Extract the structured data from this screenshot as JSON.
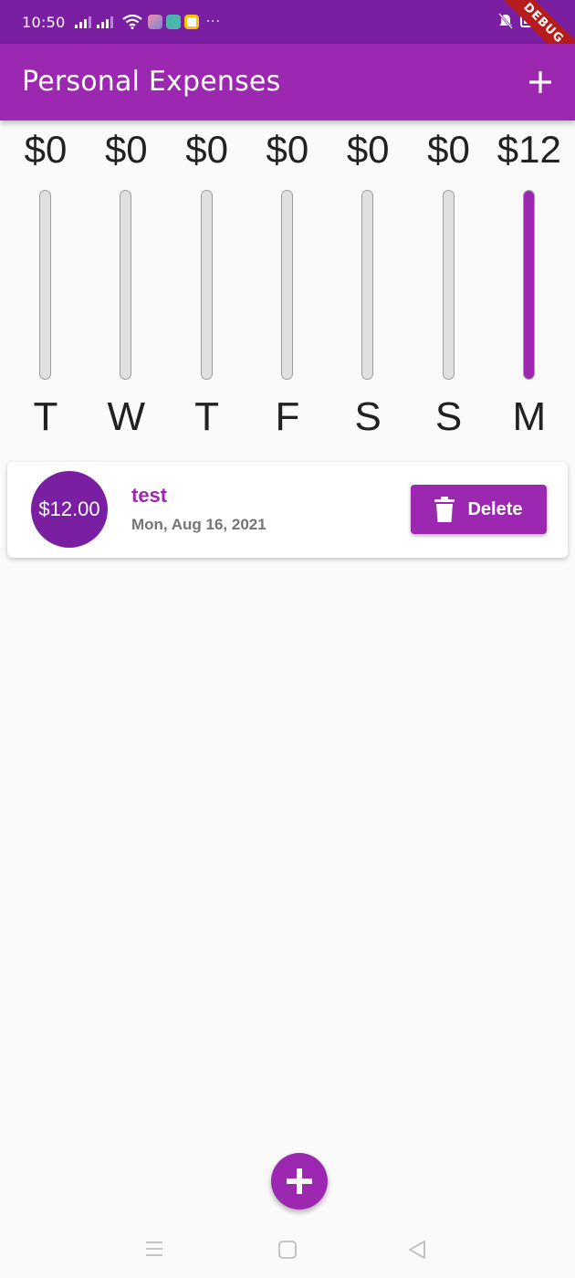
{
  "status_bar": {
    "time": "10:50",
    "icons": [
      "signal-icon",
      "signal-icon",
      "wifi-icon",
      "app-notification-icon",
      "app-notification-icon",
      "app-notification-icon",
      "more-icon",
      "mute-icon",
      "battery-icon"
    ],
    "more": "···"
  },
  "debug_banner": "DEBUG",
  "app_bar": {
    "title": "Personal Expenses",
    "action_icon": "plus-icon"
  },
  "chart": {
    "columns": [
      {
        "amount": "$0",
        "day": "T",
        "fill": 0
      },
      {
        "amount": "$0",
        "day": "W",
        "fill": 0
      },
      {
        "amount": "$0",
        "day": "T",
        "fill": 0
      },
      {
        "amount": "$0",
        "day": "F",
        "fill": 0
      },
      {
        "amount": "$0",
        "day": "S",
        "fill": 0
      },
      {
        "amount": "$0",
        "day": "S",
        "fill": 0
      },
      {
        "amount": "$12",
        "day": "M",
        "fill": 1
      }
    ]
  },
  "transactions": [
    {
      "amount": "$12.00",
      "title": "test",
      "date": "Mon, Aug 16, 2021",
      "delete_label": "Delete",
      "delete_icon": "trash-icon"
    }
  ],
  "fab_icon": "plus-icon",
  "nav_bar": [
    "menu-icon",
    "home-icon",
    "back-icon"
  ],
  "colors": {
    "primary": "#9c27b0",
    "primary_dark": "#7b1fa2",
    "track": "#e0e0e0",
    "background": "#fafafa"
  }
}
